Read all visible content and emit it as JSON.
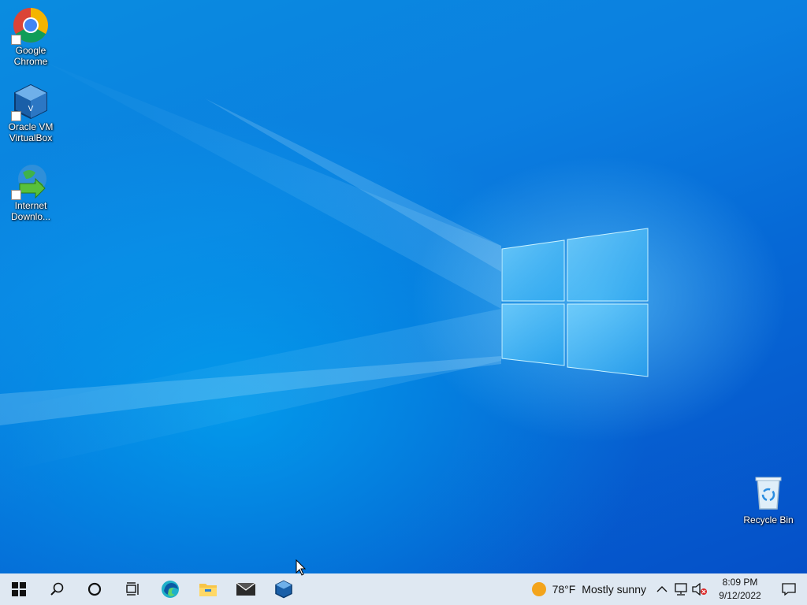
{
  "desktop": {
    "icons": [
      {
        "label_line1": "Google",
        "label_line2": "Chrome",
        "icon": "chrome-icon"
      },
      {
        "label_line1": "Oracle VM",
        "label_line2": "VirtualBox",
        "icon": "virtualbox-icon"
      },
      {
        "label_line1": "Internet",
        "label_line2": "Downlo...",
        "icon": "idm-icon"
      }
    ],
    "recycle_bin": {
      "label": "Recycle Bin",
      "icon": "recycle-bin-icon"
    }
  },
  "taskbar": {
    "pinned": [
      "start-icon",
      "search-icon",
      "cortana-icon",
      "task-view-icon",
      "edge-icon",
      "file-explorer-icon",
      "mail-icon",
      "virtualbox-icon"
    ],
    "weather": {
      "temp": "78°F",
      "condition": "Mostly sunny",
      "icon": "sun-icon"
    },
    "clock": {
      "time": "8:09 PM",
      "date": "9/12/2022"
    },
    "tray": [
      "chevron-up-icon",
      "network-icon",
      "volume-muted-icon"
    ],
    "accent_color": "#0a78d7"
  }
}
